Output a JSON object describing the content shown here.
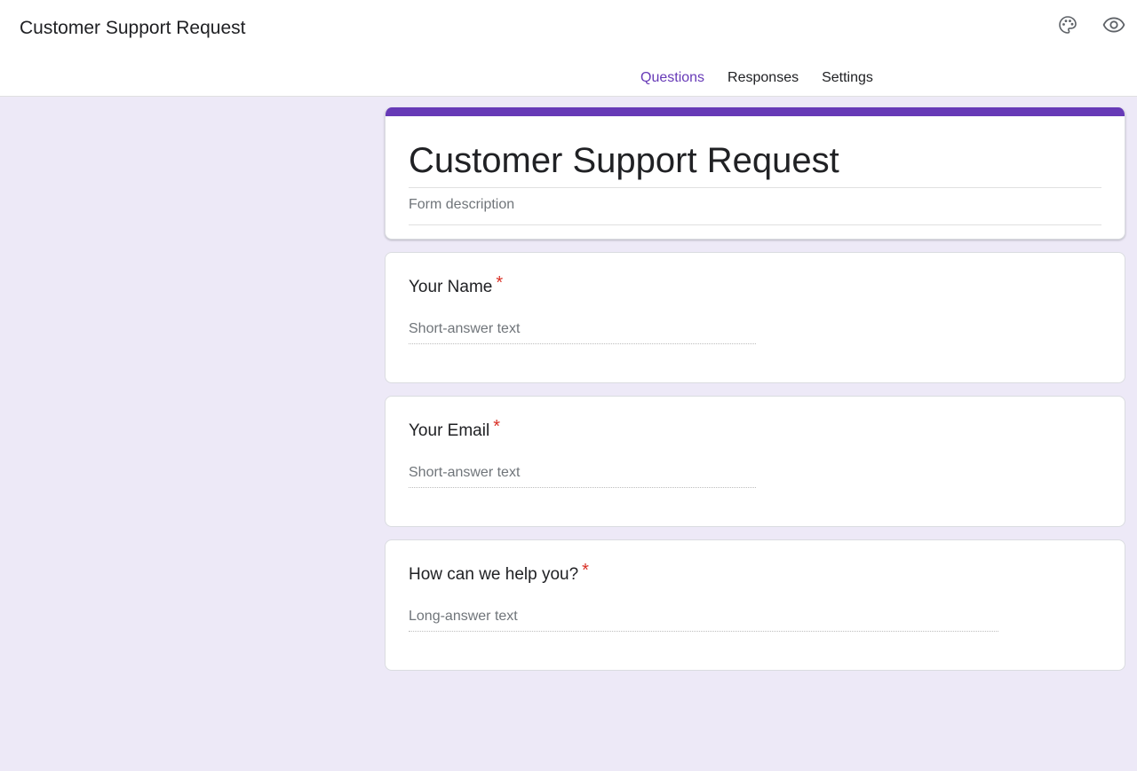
{
  "header": {
    "doc_title": "Customer Support Request",
    "icons": [
      "palette-icon",
      "eye-icon"
    ]
  },
  "tabs": [
    {
      "label": "Questions",
      "active": true
    },
    {
      "label": "Responses",
      "active": false
    },
    {
      "label": "Settings",
      "active": false
    }
  ],
  "form": {
    "title": "Customer Support Request",
    "description_placeholder": "Form description",
    "accent_color": "#673ab7"
  },
  "questions": [
    {
      "title": "Your Name",
      "required_mark": "*",
      "answer_placeholder": "Short-answer text"
    },
    {
      "title": "Your Email",
      "required_mark": "*",
      "answer_placeholder": "Short-answer text"
    },
    {
      "title": "How can we help you?",
      "required_mark": "*",
      "answer_placeholder": "Long-answer text"
    }
  ],
  "colors": {
    "background": "#ede9f7",
    "accent": "#673ab7",
    "required": "#d93025"
  }
}
